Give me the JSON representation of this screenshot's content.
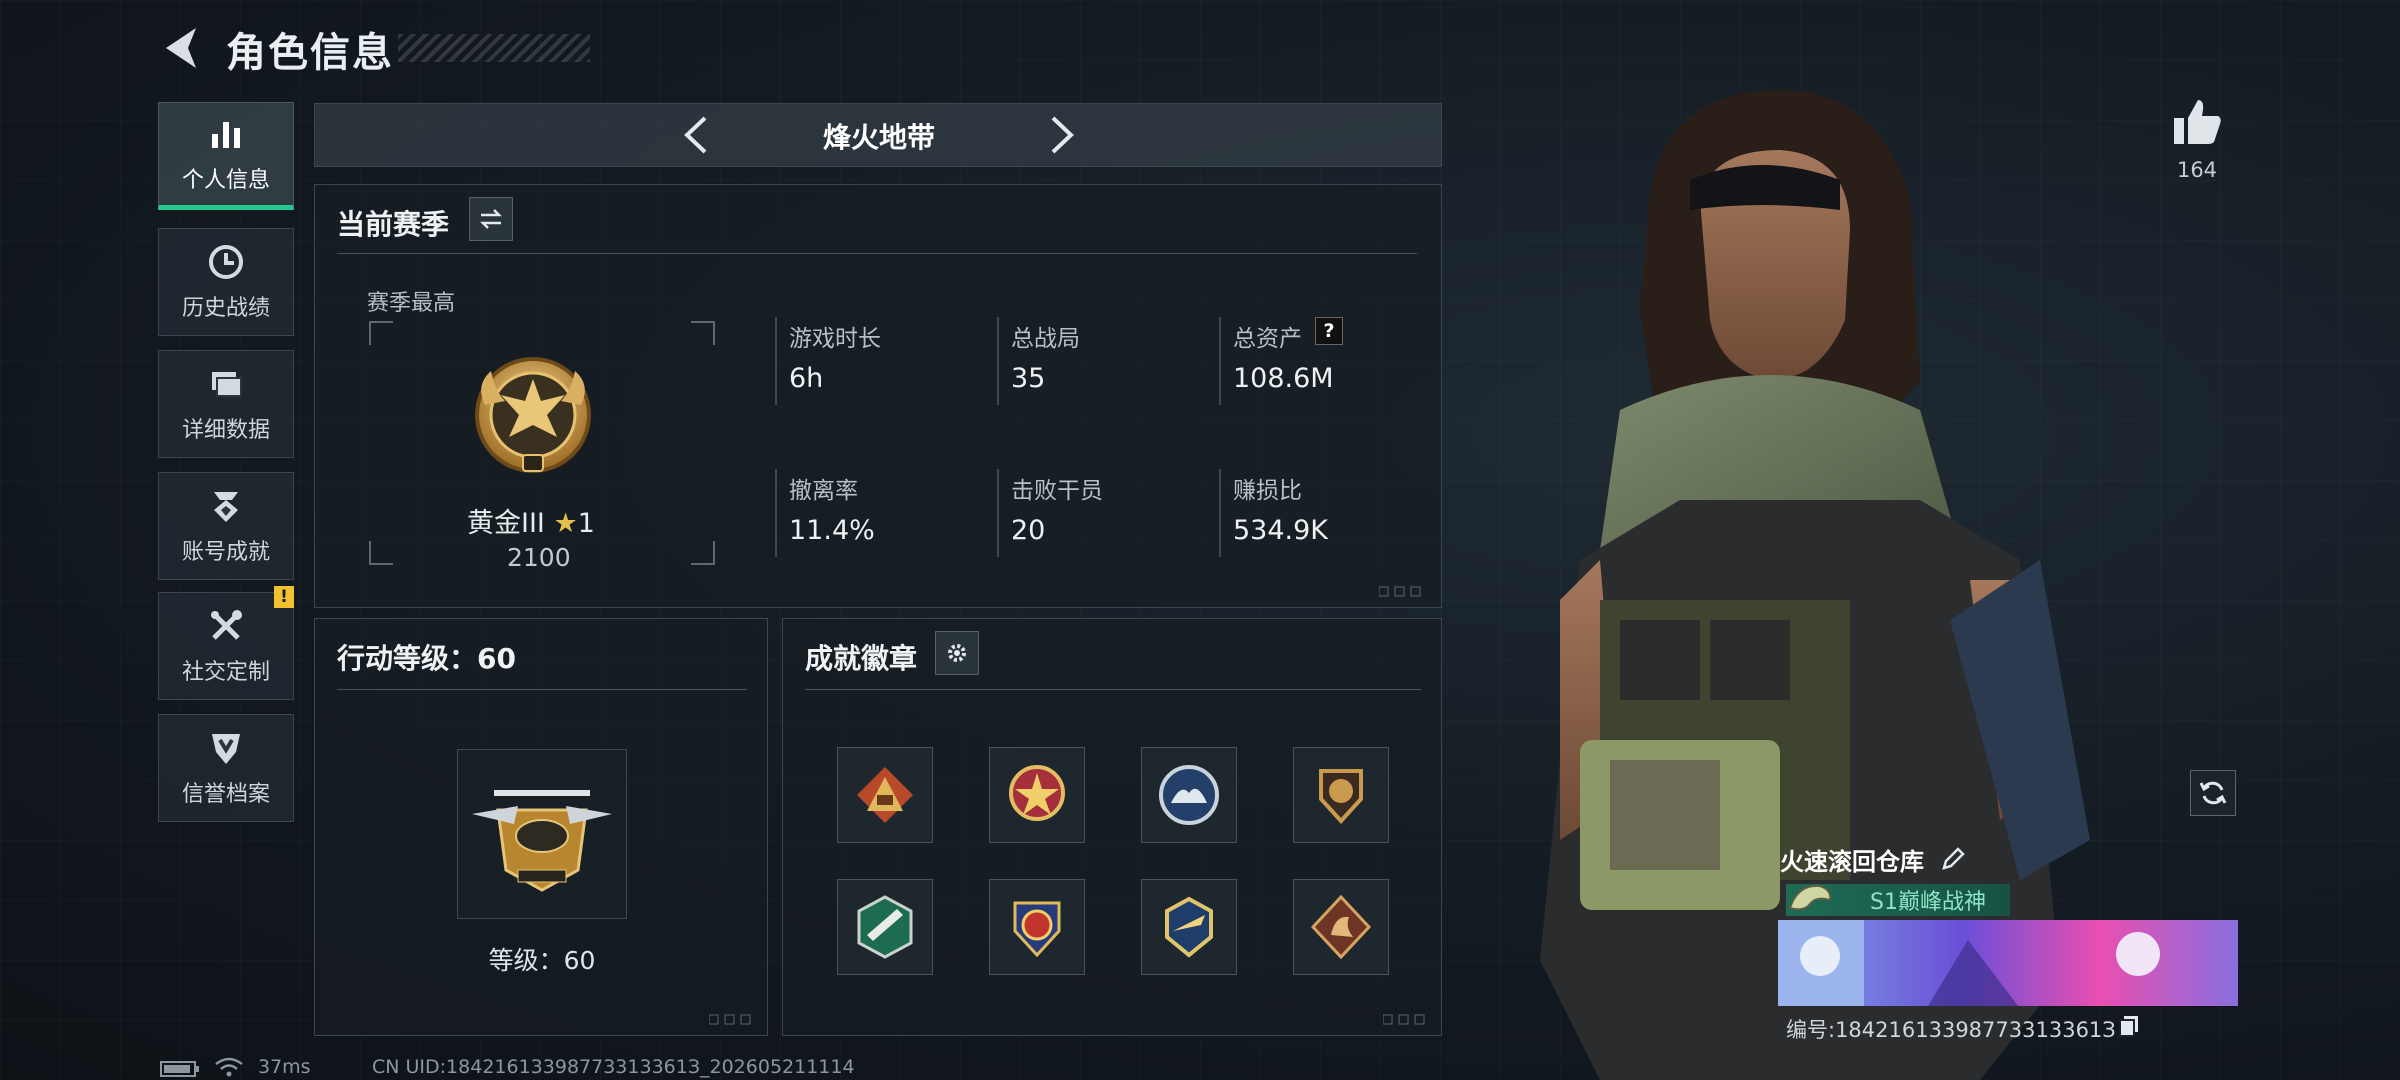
{
  "header": {
    "title": "角色信息",
    "back_icon": "back-arrow-icon"
  },
  "sidebar": {
    "items": [
      {
        "label": "个人信息",
        "icon": "bar-chart-icon",
        "active": true
      },
      {
        "label": "历史战绩",
        "icon": "clock-icon"
      },
      {
        "label": "详细数据",
        "icon": "folders-icon"
      },
      {
        "label": "账号成就",
        "icon": "achievement-icon"
      },
      {
        "label": "社交定制",
        "icon": "tools-icon",
        "alert": "!"
      },
      {
        "label": "信誉档案",
        "icon": "shield-rank-icon"
      }
    ]
  },
  "mode_selector": {
    "title": "烽火地带"
  },
  "season": {
    "title": "当前赛季",
    "best_label": "赛季最高",
    "rank_name": "黄金III",
    "rank_stars": "1",
    "rank_score": "2100",
    "stats": [
      {
        "label": "游戏时长",
        "value": "6h"
      },
      {
        "label": "总战局",
        "value": "35"
      },
      {
        "label": "总资产",
        "value": "108.6M",
        "help": "?"
      },
      {
        "label": "撤离率",
        "value": "11.4%"
      },
      {
        "label": "击败干员",
        "value": "20"
      },
      {
        "label": "赚损比",
        "value": "534.9K"
      }
    ]
  },
  "action_level": {
    "title": "行动等级：60",
    "level_text": "等级：60"
  },
  "achievements": {
    "title": "成就徽章",
    "badges": [
      "triangle-badge-icon",
      "star-badge-icon",
      "wave-badge-icon",
      "lion-badge-icon",
      "gun-badge-icon",
      "star-shield-badge-icon",
      "winged-badge-icon",
      "dragon-badge-icon"
    ]
  },
  "likes": {
    "count": "164",
    "icon": "thumbs-up-icon"
  },
  "player_card": {
    "name": "火速滚回仓库",
    "title": "S1巅峰战神",
    "id_text": "编号:18421613398773313361З"
  },
  "status_bar": {
    "ping": "37ms",
    "uid": "CN UID:18421613398773313361З_202605211114"
  },
  "colors": {
    "accent": "#27c790",
    "warning": "#f0c230",
    "gold": "#d8a74a"
  }
}
